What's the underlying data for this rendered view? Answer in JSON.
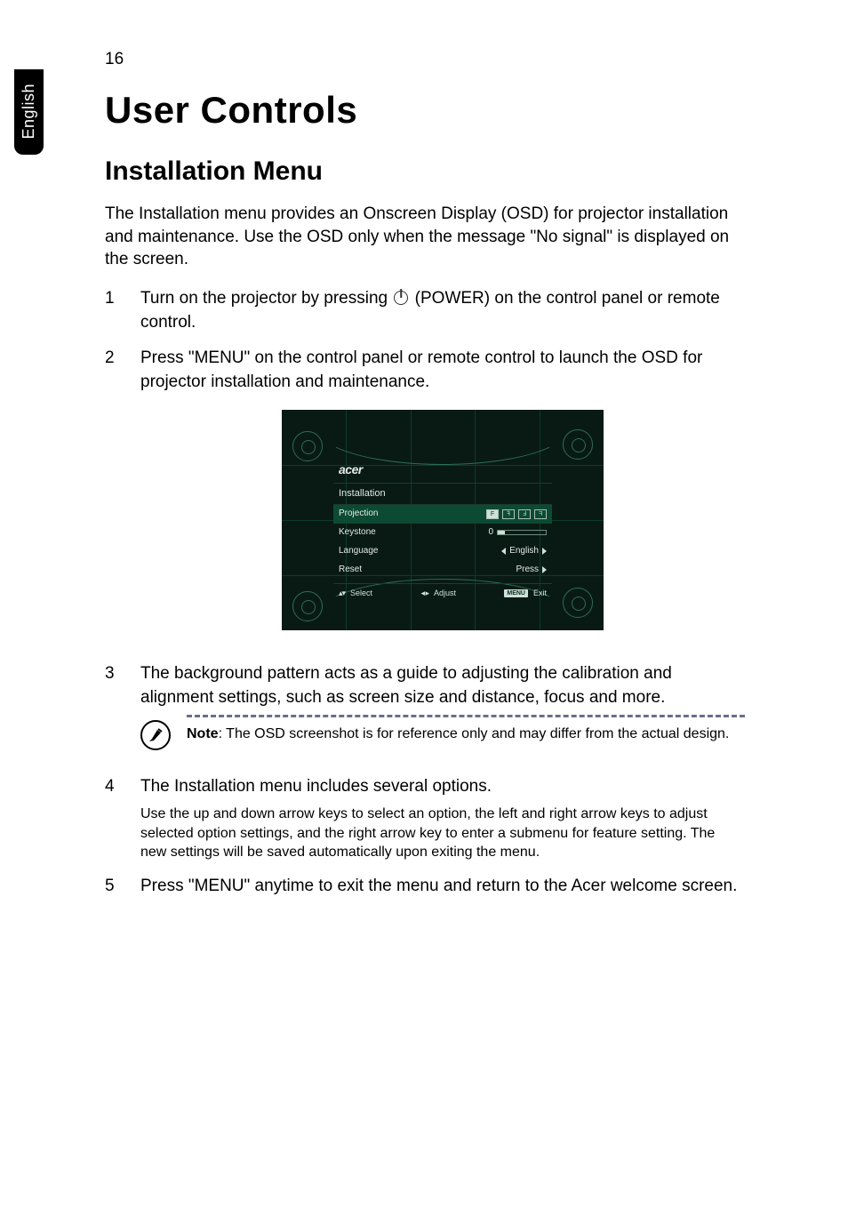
{
  "page": {
    "number": "16",
    "language_tab": "English"
  },
  "headings": {
    "h1": "User Controls",
    "h2": "Installation Menu"
  },
  "intro": "The Installation menu provides an Onscreen Display (OSD) for projector installation and maintenance. Use the OSD only when the message \"No signal\" is displayed on the screen.",
  "steps": {
    "s1_before": "Turn on the projector by pressing ",
    "s1_after": " (POWER) on the control panel or remote control.",
    "s2": "Press \"MENU\" on the control panel or remote control to launch the OSD for projector installation and maintenance.",
    "s3": "The background pattern acts as a guide to adjusting the calibration and alignment settings, such as screen size and distance, focus and more.",
    "s4_main": "The Installation menu includes several options.",
    "s4_sub": "Use the up and down arrow keys to select an option, the left and right arrow keys to adjust selected option settings, and the right arrow key to enter a submenu for feature setting. The new settings will be saved automatically upon exiting the menu.",
    "s5": "Press \"MENU\" anytime to exit the menu and return to the Acer welcome screen."
  },
  "note": {
    "label": "Note",
    "text": ": The OSD screenshot is for reference only and may differ from the actual design."
  },
  "osd": {
    "brand": "acer",
    "title": "Installation",
    "rows": {
      "projection": {
        "label": "Projection"
      },
      "keystone": {
        "label": "Keystone",
        "value": "0"
      },
      "language": {
        "label": "Language",
        "value": "English"
      },
      "reset": {
        "label": "Reset",
        "value": "Press"
      }
    },
    "footer": {
      "select": "Select",
      "adjust": "Adjust",
      "menu_badge": "MENU",
      "exit": "Exit"
    }
  }
}
